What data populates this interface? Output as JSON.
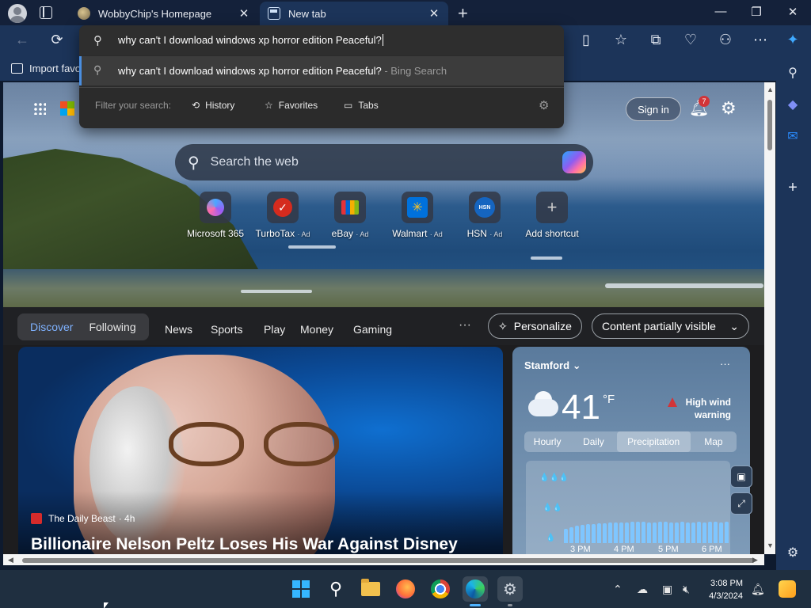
{
  "browser": {
    "tabs": [
      {
        "label": "WobbyChip's Homepage",
        "close": "✕"
      },
      {
        "label": "New tab",
        "close": "✕"
      }
    ],
    "new_tab_glyph": "+",
    "window_controls": {
      "minimize": "—",
      "restore": "❐",
      "close": "✕"
    },
    "toolbar_icons": [
      "back-icon",
      "refresh-icon",
      "split-screen-icon",
      "favorites-icon",
      "collections-icon",
      "health-icon",
      "extensions-icon",
      "more-icon",
      "copilot-icon"
    ],
    "bookmarks_bar": {
      "import_label": "Import favo"
    }
  },
  "address_dropdown": {
    "query": "why can't I download windows xp horror edition Peaceful?",
    "suggestion": {
      "text": "why can't I download windows xp horror edition Peaceful?",
      "source": " - Bing Search"
    },
    "filter_label": "Filter your search:",
    "filters": [
      {
        "label": "History",
        "icon": "history-icon"
      },
      {
        "label": "Favorites",
        "icon": "star-icon"
      },
      {
        "label": "Tabs",
        "icon": "tabs-icon"
      }
    ]
  },
  "newtab": {
    "signin": "Sign in",
    "notifications_count": "7",
    "search_placeholder": "Search the web",
    "shortcuts": [
      {
        "name": "Microsoft 365",
        "ad": ""
      },
      {
        "name": "TurboTax",
        "ad": "· Ad"
      },
      {
        "name": "eBay",
        "ad": "· Ad"
      },
      {
        "name": "Walmart",
        "ad": "· Ad"
      },
      {
        "name": "HSN",
        "ad": "· Ad"
      },
      {
        "name": "Add shortcut",
        "ad": ""
      }
    ],
    "hsn_logo_text": "HSN",
    "feed_nav": {
      "discover": "Discover",
      "following": "Following",
      "links": [
        "News",
        "Sports",
        "Play",
        "Money",
        "Gaming"
      ],
      "more": "···",
      "personalize": "Personalize",
      "content_visibility": "Content partially visible"
    },
    "news_card": {
      "source": "The Daily Beast",
      "age": "· 4h",
      "headline": "Billionaire Nelson Peltz Loses His War Against Disney"
    },
    "weather": {
      "city": "Stamford",
      "temperature": "41",
      "unit": "°F",
      "alert": "High wind warning",
      "tabs": [
        "Hourly",
        "Daily",
        "Precipitation",
        "Map"
      ],
      "active_tab": "Precipitation",
      "time_labels": [
        "3 PM",
        "4 PM",
        "5 PM",
        "6 PM"
      ]
    }
  },
  "taskbar": {
    "clock_time": "3:08 PM",
    "clock_date": "4/3/2024",
    "apps": [
      "windows-start",
      "search",
      "file-explorer",
      "firefox",
      "chrome",
      "edge",
      "settings"
    ]
  },
  "colors": {
    "tab_bg": "#14213a",
    "toolbar_bg": "#1c3459",
    "accent": "#4fb3ff",
    "taskbar_bg": "#1f2f40"
  }
}
